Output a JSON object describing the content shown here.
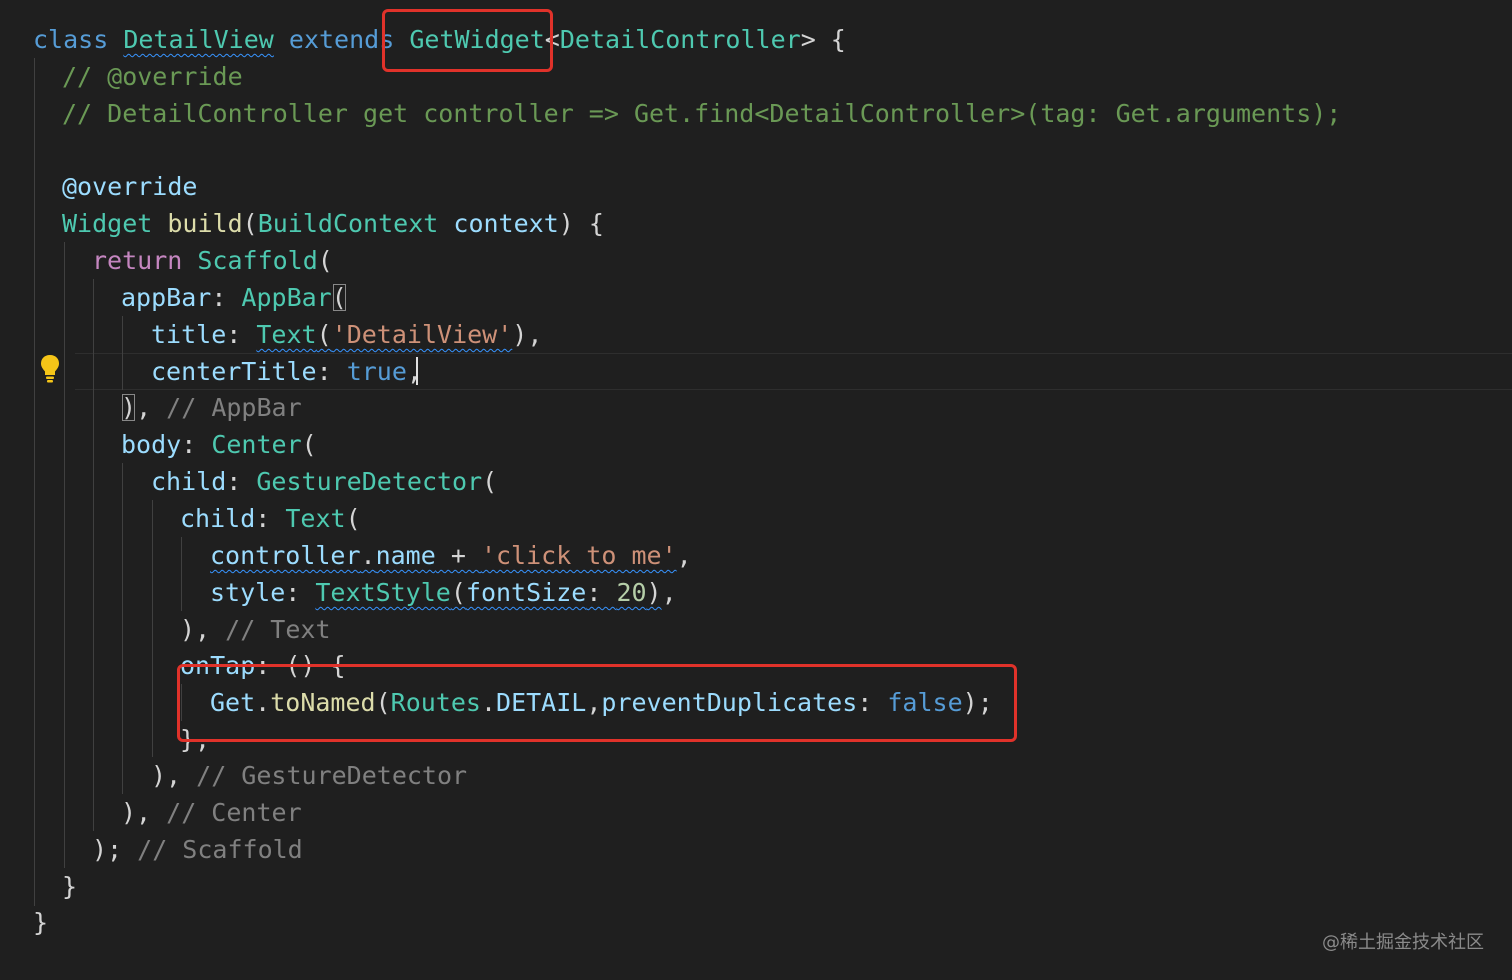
{
  "code_lines": [
    [
      {
        "t": "class",
        "c": "keyword"
      },
      {
        "t": " "
      },
      {
        "t": "DetailView",
        "c": "type",
        "u": 1
      },
      {
        "t": " "
      },
      {
        "t": "extends",
        "c": "keyword"
      },
      {
        "t": " "
      },
      {
        "t": "GetWidget",
        "c": "type"
      },
      {
        "t": "<",
        "c": "punct"
      },
      {
        "t": "DetailController",
        "c": "type"
      },
      {
        "t": "> {",
        "c": "punct"
      }
    ],
    [
      {
        "t": "// @override",
        "c": "comment"
      }
    ],
    [
      {
        "t": "// DetailController get controller => Get.find<DetailController>(tag: Get.arguments);",
        "c": "comment"
      }
    ],
    [],
    [
      {
        "t": "@override",
        "c": "var"
      }
    ],
    [
      {
        "t": "Widget",
        "c": "type"
      },
      {
        "t": " "
      },
      {
        "t": "build",
        "c": "func"
      },
      {
        "t": "(",
        "c": "punct"
      },
      {
        "t": "BuildContext",
        "c": "type"
      },
      {
        "t": " "
      },
      {
        "t": "context",
        "c": "var"
      },
      {
        "t": ") {",
        "c": "punct"
      }
    ],
    [
      {
        "t": "return",
        "c": "control"
      },
      {
        "t": " "
      },
      {
        "t": "Scaffold",
        "c": "type"
      },
      {
        "t": "(",
        "c": "punct"
      }
    ],
    [
      {
        "t": "appBar",
        "c": "var"
      },
      {
        "t": ": ",
        "c": "punct"
      },
      {
        "t": "AppBar",
        "c": "type"
      },
      {
        "t": "(",
        "c": "punct",
        "b": 1
      }
    ],
    [
      {
        "t": "title",
        "c": "var"
      },
      {
        "t": ": ",
        "c": "punct"
      },
      {
        "t": "Text",
        "c": "type",
        "u": 1
      },
      {
        "t": "(",
        "c": "punct",
        "u": 1
      },
      {
        "t": "'DetailView'",
        "c": "string",
        "u": 1
      },
      {
        "t": "),",
        "c": "punct"
      }
    ],
    [
      {
        "t": "centerTitle",
        "c": "var"
      },
      {
        "t": ": ",
        "c": "punct"
      },
      {
        "t": "true",
        "c": "keyword"
      },
      {
        "t": ",",
        "c": "punct"
      }
    ],
    [
      {
        "t": ")",
        "c": "punct",
        "b": 1
      },
      {
        "t": ", ",
        "c": "punct"
      },
      {
        "t": "// AppBar",
        "c": "hint"
      }
    ],
    [
      {
        "t": "body",
        "c": "var"
      },
      {
        "t": ": ",
        "c": "punct"
      },
      {
        "t": "Center",
        "c": "type"
      },
      {
        "t": "(",
        "c": "punct"
      }
    ],
    [
      {
        "t": "child",
        "c": "var"
      },
      {
        "t": ": ",
        "c": "punct"
      },
      {
        "t": "GestureDetector",
        "c": "type"
      },
      {
        "t": "(",
        "c": "punct"
      }
    ],
    [
      {
        "t": "child",
        "c": "var"
      },
      {
        "t": ": ",
        "c": "punct"
      },
      {
        "t": "Text",
        "c": "type"
      },
      {
        "t": "(",
        "c": "punct"
      }
    ],
    [
      {
        "t": "controller",
        "c": "var",
        "u": 1
      },
      {
        "t": ".",
        "c": "punct",
        "u": 1
      },
      {
        "t": "name",
        "c": "var",
        "u": 1
      },
      {
        "t": " + ",
        "c": "punct",
        "u": 1
      },
      {
        "t": "'click to me'",
        "c": "string",
        "u": 1
      },
      {
        "t": ",",
        "c": "punct"
      }
    ],
    [
      {
        "t": "style",
        "c": "var"
      },
      {
        "t": ": ",
        "c": "punct"
      },
      {
        "t": "TextStyle",
        "c": "type",
        "u": 1
      },
      {
        "t": "(",
        "c": "punct",
        "u": 1
      },
      {
        "t": "fontSize",
        "c": "var",
        "u": 1
      },
      {
        "t": ": ",
        "c": "punct",
        "u": 1
      },
      {
        "t": "20",
        "c": "number",
        "u": 1
      },
      {
        "t": ")",
        "c": "punct",
        "u": 1
      },
      {
        "t": ",",
        "c": "punct"
      }
    ],
    [
      {
        "t": "), ",
        "c": "punct"
      },
      {
        "t": "// Text",
        "c": "hint"
      }
    ],
    [
      {
        "t": "onTap",
        "c": "var"
      },
      {
        "t": ": () {",
        "c": "punct"
      }
    ],
    [
      {
        "t": "Get",
        "c": "var"
      },
      {
        "t": ".",
        "c": "punct"
      },
      {
        "t": "toNamed",
        "c": "func"
      },
      {
        "t": "(",
        "c": "punct"
      },
      {
        "t": "Routes",
        "c": "type"
      },
      {
        "t": ".",
        "c": "punct"
      },
      {
        "t": "DETAIL",
        "c": "var"
      },
      {
        "t": ",",
        "c": "punct"
      },
      {
        "t": "preventDuplicates",
        "c": "var"
      },
      {
        "t": ": ",
        "c": "punct"
      },
      {
        "t": "false",
        "c": "keyword"
      },
      {
        "t": ");",
        "c": "punct"
      }
    ],
    [
      {
        "t": "},",
        "c": "punct"
      }
    ],
    [
      {
        "t": "), ",
        "c": "punct"
      },
      {
        "t": "// GestureDetector",
        "c": "hint"
      }
    ],
    [
      {
        "t": "), ",
        "c": "punct"
      },
      {
        "t": "// Center",
        "c": "hint"
      }
    ],
    [
      {
        "t": "); ",
        "c": "punct"
      },
      {
        "t": "// Scaffold",
        "c": "hint"
      }
    ],
    [
      {
        "t": "}",
        "c": "punct"
      }
    ],
    [
      {
        "t": "}",
        "c": "punct"
      }
    ]
  ],
  "watermark": "@稀土掘金技术社区",
  "colors": {
    "background": "#1f1f1f",
    "keyword": "#569cd6",
    "type": "#4ec9b0",
    "string": "#ce9178",
    "comment": "#6a9955",
    "annotation_box": "#e0322a",
    "lightbulb": "#f5c518"
  },
  "icons": [
    "lightbulb-icon"
  ]
}
